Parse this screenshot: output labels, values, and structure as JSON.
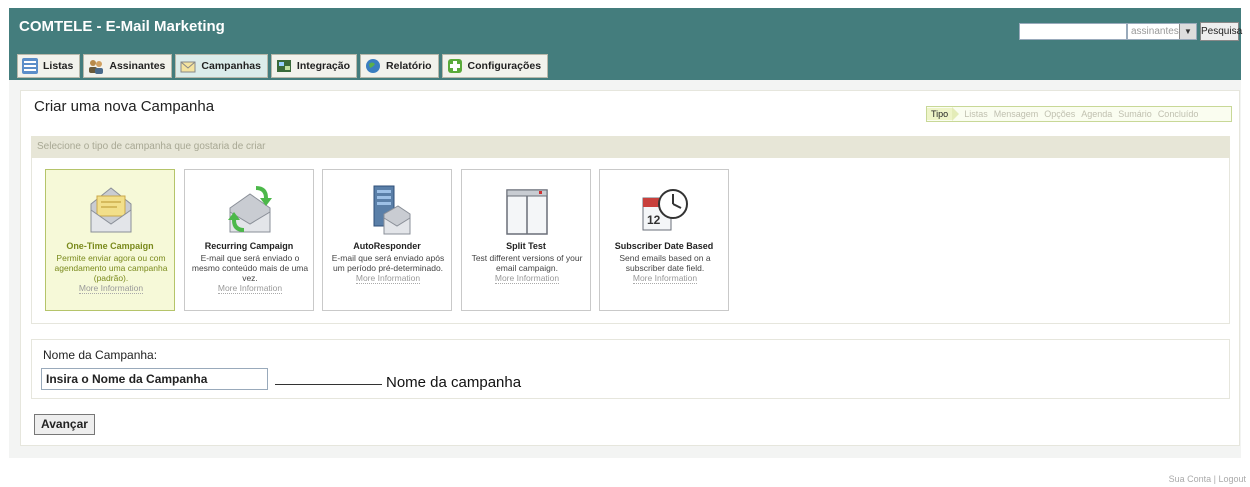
{
  "header": {
    "app_title": "COMTELE - E-Mail Marketing",
    "search_value": "",
    "search_scope": "assinantes",
    "search_button": "Pesquisa"
  },
  "tabs": [
    {
      "label": "Listas",
      "icon": "lists-icon"
    },
    {
      "label": "Assinantes",
      "icon": "users-icon"
    },
    {
      "label": "Campanhas",
      "icon": "envelope-icon",
      "active": true
    },
    {
      "label": "Integração",
      "icon": "integration-icon"
    },
    {
      "label": "Relatório",
      "icon": "globe-icon"
    },
    {
      "label": "Configurações",
      "icon": "settings-icon"
    }
  ],
  "page": {
    "title": "Criar uma nova Campanha",
    "steps": [
      "Tipo",
      "Listas",
      "Mensagem",
      "Opções",
      "Agenda",
      "Sumário",
      "Concluído"
    ],
    "active_step": "Tipo",
    "select_prompt": "Selecione o tipo de campanha que gostaria de criar"
  },
  "campaign_types": [
    {
      "title": "One-Time Campaign",
      "desc": "Permite enviar agora ou com agendamento uma campanha (padrão).",
      "more": "More Information",
      "icon": "envelope-icon",
      "selected": true
    },
    {
      "title": "Recurring Campaign",
      "desc": "E-mail que será enviado o mesmo conteúdo mais de uma vez.",
      "more": "More Information",
      "icon": "recurring-envelope-icon",
      "selected": false
    },
    {
      "title": "AutoResponder",
      "desc": "E-mail que será enviado após um período pré-determinado.",
      "more": "More Information",
      "icon": "server-envelope-icon",
      "selected": false
    },
    {
      "title": "Split Test",
      "desc": "Test different versions of your email campaign.",
      "more": "More Information",
      "icon": "split-window-icon",
      "selected": false
    },
    {
      "title": "Subscriber Date Based",
      "desc": "Send emails based on a subscriber date field.",
      "more": "More Information",
      "icon": "calendar-clock-icon",
      "selected": false
    }
  ],
  "form": {
    "name_label": "Nome da Campanha:",
    "name_value": "Insira o Nome da Campanha",
    "annotation": "Nome da campanha",
    "next_button": "Avançar"
  },
  "footer": {
    "account": "Sua Conta",
    "separator": "|",
    "logout": "Logout"
  },
  "colors": {
    "header": "#447d7d",
    "selected_card": "#f6f9d8",
    "selected_text": "#7a8a1c"
  }
}
